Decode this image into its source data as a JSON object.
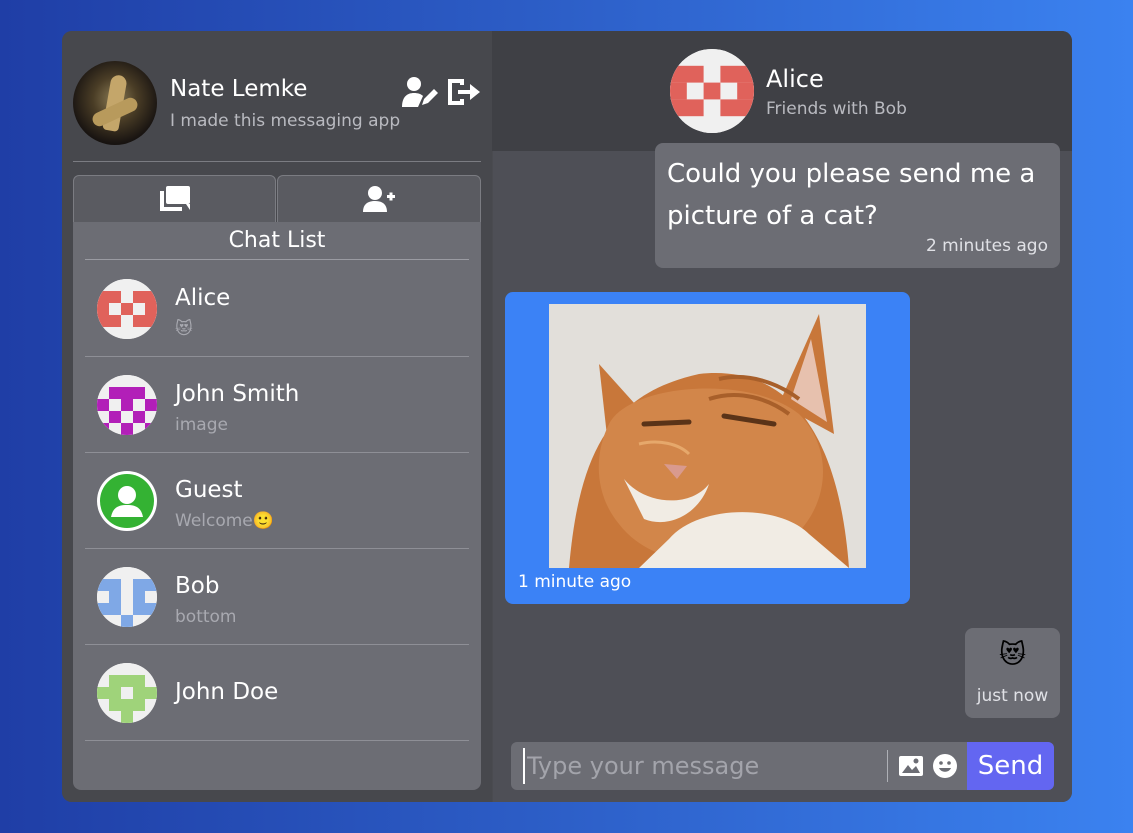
{
  "user": {
    "name": "Nate Lemke",
    "status": "I made this messaging app"
  },
  "tabs": {
    "chats_icon": "chat-bubbles-icon",
    "add_icon": "add-user-icon"
  },
  "chat_list": {
    "title": "Chat List",
    "items": [
      {
        "name": "Alice",
        "preview": "😻",
        "avatar_color": "#e0625b"
      },
      {
        "name": "John Smith",
        "preview": "image",
        "avatar_color": "#b21fb8"
      },
      {
        "name": "Guest",
        "preview": "Welcome🙂",
        "avatar_color": "#34b233"
      },
      {
        "name": "Bob",
        "preview": "bottom",
        "avatar_color": "#7fa8e6"
      },
      {
        "name": "John Doe",
        "preview": "",
        "avatar_color": "#9fd37a"
      }
    ]
  },
  "conversation": {
    "name": "Alice",
    "subtitle": "Friends with Bob",
    "messages": [
      {
        "type": "text",
        "text": "Could you please send me a picture of a cat?",
        "time": "2 minutes ago"
      },
      {
        "type": "image",
        "time": "1 minute ago"
      },
      {
        "type": "text",
        "text": "😻",
        "time": "just now"
      }
    ]
  },
  "composer": {
    "placeholder": "Type your message",
    "send_label": "Send",
    "image_icon": "image-icon",
    "emoji_icon": "emoji-icon"
  },
  "colors": {
    "accent": "#3b82f6",
    "send": "#6366f1"
  }
}
